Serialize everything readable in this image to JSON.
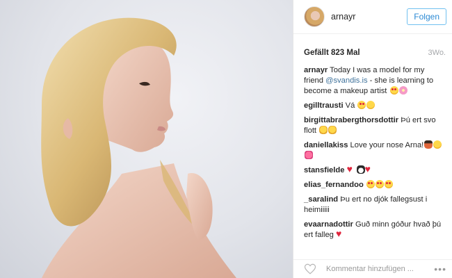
{
  "post": {
    "image": {
      "alt_icon": "photo-of-woman-profile"
    },
    "header": {
      "username": "arnayr",
      "follow_label": "Folgen"
    },
    "likes": "Gefällt 823 Mal",
    "age": "3Wo.",
    "comments": [
      {
        "user": "arnayr",
        "segments": [
          {
            "text": " Today I was a model for my friend "
          },
          {
            "mention": "@svandis.is"
          },
          {
            "text": " - she is learning to become a makeup artist "
          }
        ],
        "emojis": [
          "heart-eyes",
          "flower"
        ]
      },
      {
        "user": "egilltrausti",
        "segments": [
          {
            "text": " Vá "
          }
        ],
        "emojis": [
          "heart-eyes",
          "face"
        ]
      },
      {
        "user": "birgittabrabergthorsdottir",
        "segments": [
          {
            "text": " Þú ert svo flott "
          }
        ],
        "emojis": [
          "hands",
          "hands"
        ]
      },
      {
        "user": "daniellakiss",
        "segments": [
          {
            "text": " Love your nose Arna!"
          }
        ],
        "emojis": [
          "dancer",
          "face",
          "pinkheart"
        ]
      },
      {
        "user": "stansfielde",
        "segments": [
          {
            "text": " "
          }
        ],
        "emojis": [
          "heart",
          "penguin",
          "heart"
        ]
      },
      {
        "user": "elias_fernandoo",
        "segments": [
          {
            "text": " "
          }
        ],
        "emojis": [
          "heart-eyes",
          "heart-eyes",
          "heart-eyes"
        ]
      },
      {
        "user": "_saralind",
        "segments": [
          {
            "text": " Þu ert no djók fallegsust i heimiiiii"
          }
        ],
        "emojis": []
      },
      {
        "user": "evaarnadottir",
        "segments": [
          {
            "text": " Guð minn góður hvað þú ert falleg "
          }
        ],
        "emojis": [
          "heart"
        ]
      }
    ],
    "footer": {
      "comment_placeholder": "Kommentar hinzufügen ...",
      "more_label": "•••"
    }
  },
  "colors": {
    "follow_border": "#70c0f0",
    "follow_text": "#2a89d4",
    "mention": "#3f729b",
    "muted": "#a5a7aa"
  }
}
